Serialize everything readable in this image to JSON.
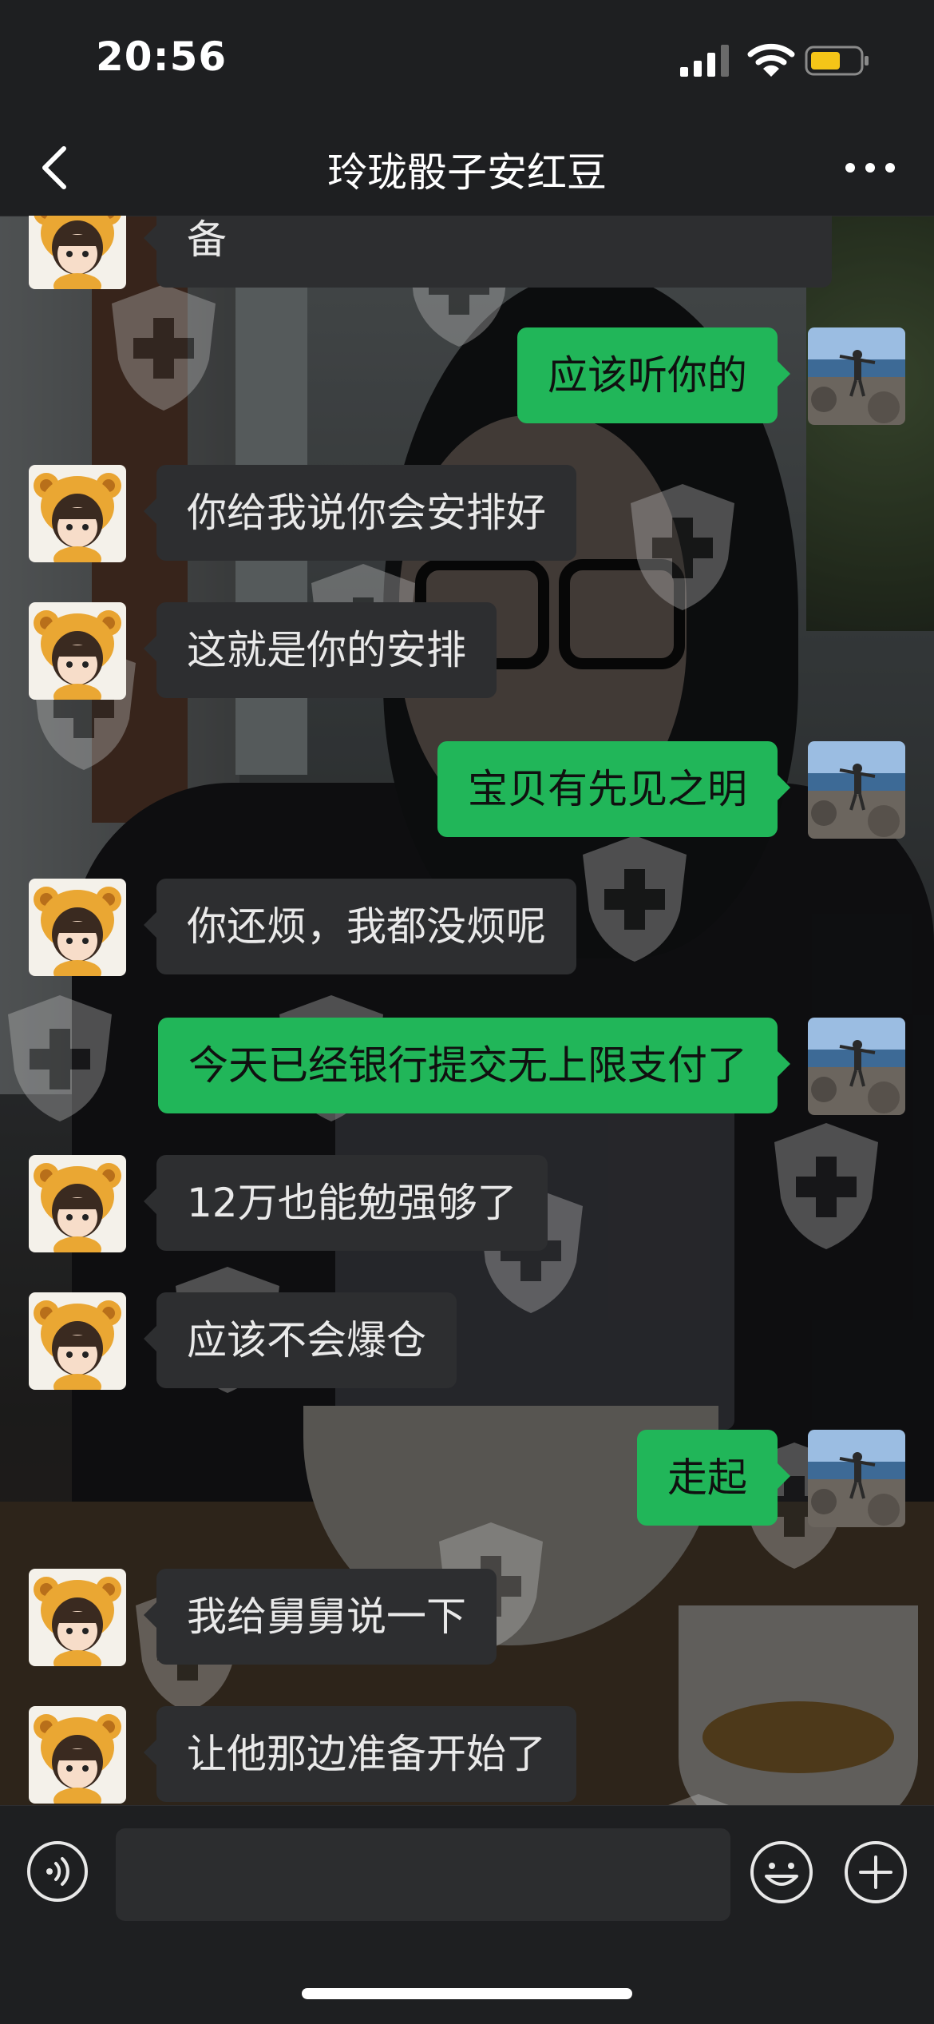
{
  "status_bar": {
    "time": "20:56",
    "signal_icon": "cellular-signal-icon",
    "wifi_icon": "wifi-icon",
    "battery_icon": "battery-icon",
    "battery_color": "#f5c518"
  },
  "nav": {
    "title": "玲珑骰子安红豆",
    "back_icon": "back-chevron-icon",
    "more_icon": "more-dots-icon"
  },
  "colors": {
    "sent_bubble": "#21b659",
    "received_bubble": "#2d2e30",
    "bar": "#1e1f21"
  },
  "messages": [
    {
      "side": "left",
      "text": "备"
    },
    {
      "side": "right",
      "text": "应该听你的"
    },
    {
      "side": "left",
      "text": "你给我说你会安排好"
    },
    {
      "side": "left",
      "text": "这就是你的安排"
    },
    {
      "side": "right",
      "text": "宝贝有先见之明"
    },
    {
      "side": "left",
      "text": "你还烦，我都没烦呢"
    },
    {
      "side": "right",
      "text": "今天已经银行提交无上限支付了"
    },
    {
      "side": "left",
      "text": "12万也能勉强够了"
    },
    {
      "side": "left",
      "text": "应该不会爆仓"
    },
    {
      "side": "right",
      "text": "走起"
    },
    {
      "side": "left",
      "text": "我给舅舅说一下"
    },
    {
      "side": "left",
      "text": "让他那边准备开始了"
    }
  ],
  "input_bar": {
    "voice_icon": "voice-input-icon",
    "emoji_icon": "emoji-icon",
    "plus_icon": "plus-circle-icon"
  }
}
